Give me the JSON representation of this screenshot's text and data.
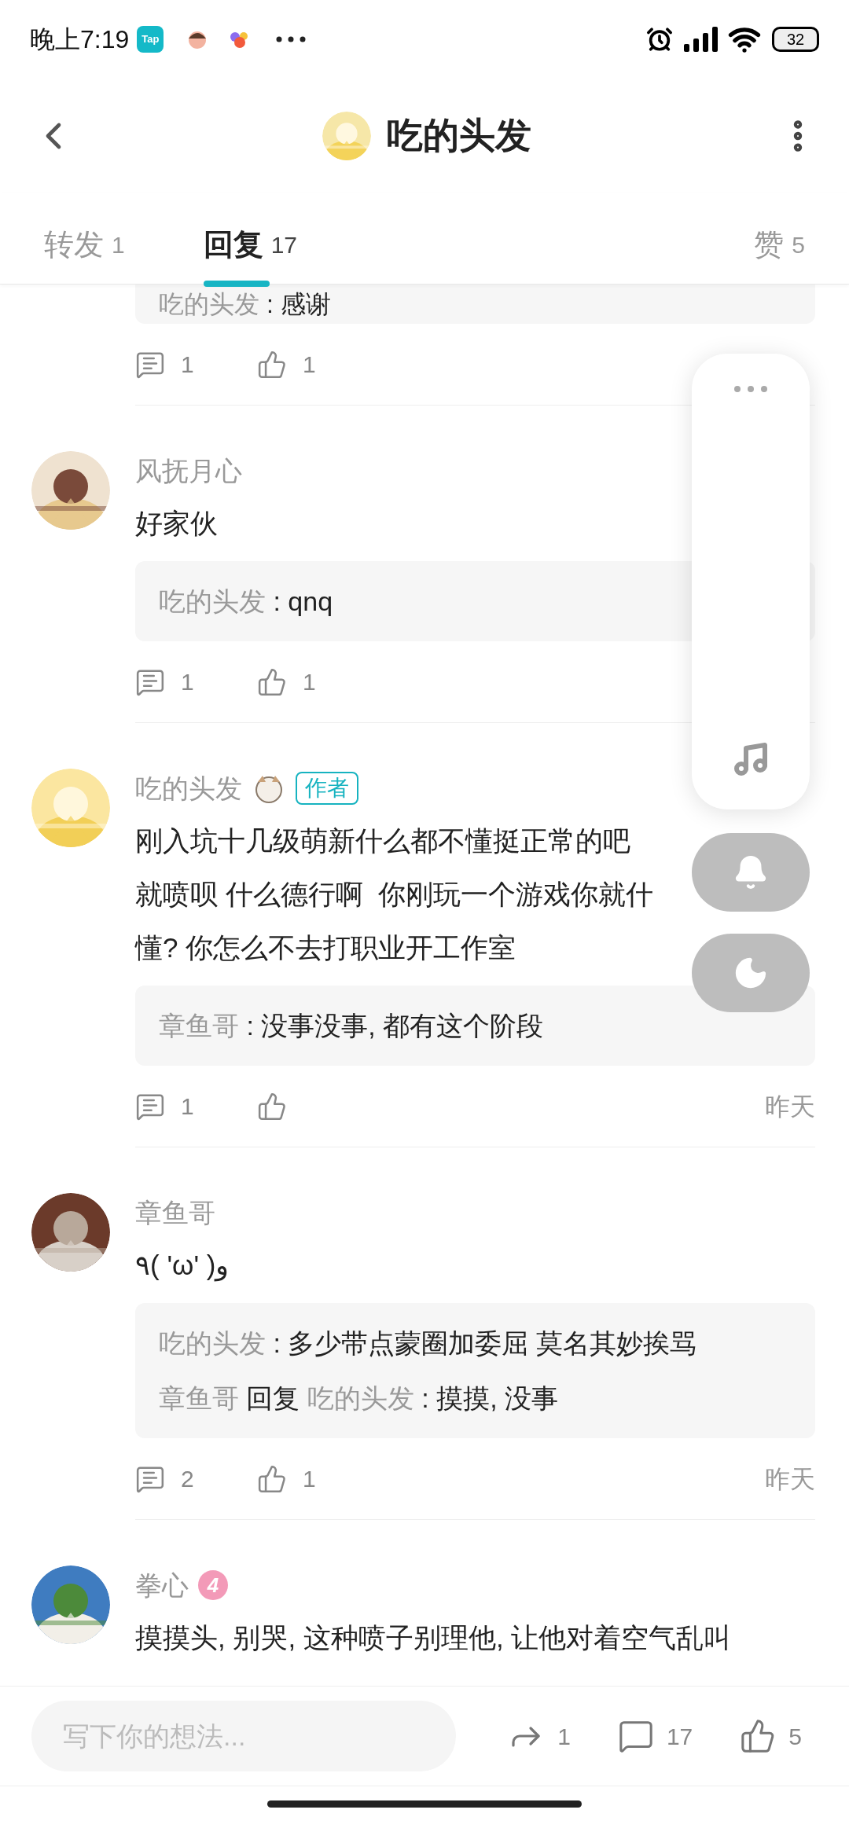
{
  "status_bar": {
    "time": "晚上7:19",
    "tap_icon_label": "Tap",
    "battery": "32"
  },
  "header": {
    "title": "吃的头发"
  },
  "tabs": [
    {
      "label": "转发",
      "count": "1",
      "selected": false
    },
    {
      "label": "回复",
      "count": "17",
      "selected": true
    },
    {
      "label": "赞",
      "count": "5",
      "selected": false
    }
  ],
  "comments": [
    {
      "kind": "partial",
      "replies": [
        {
          "author": "吃的头发",
          "text": ": 感谢"
        }
      ],
      "reply_count": "1",
      "like_count": "1"
    },
    {
      "kind": "full",
      "author": "风抚月心",
      "body": [
        "好家伙"
      ],
      "replies": [
        {
          "author": "吃的头发",
          "text": ": qnq"
        }
      ],
      "reply_count": "1",
      "like_count": "1"
    },
    {
      "kind": "full",
      "author": "吃的头发",
      "sticker": true,
      "author_tag": "作者",
      "body": [
        "刚入坑十几级萌新什么都不懂挺正常的吧",
        "就喷呗 什么德行啊  你刚玩一个游戏你就什",
        "懂? 你怎么不去打职业开工作室"
      ],
      "replies": [
        {
          "author": "章鱼哥",
          "text": ": 没事没事, 都有这个阶段"
        }
      ],
      "reply_count": "1",
      "time": "昨天"
    },
    {
      "kind": "full",
      "author": "章鱼哥",
      "body": [
        "٩( 'ω' )و"
      ],
      "replies": [
        {
          "author": "吃的头发",
          "text": ": 多少带点蒙圈加委屈 莫名其妙挨骂"
        },
        {
          "author": "章鱼哥",
          "verb": "回复",
          "reply_to": "吃的头发",
          "text": ": 摸摸, 没事"
        }
      ],
      "reply_count": "2",
      "like_count": "1",
      "time": "昨天"
    },
    {
      "kind": "full",
      "author": "拳心",
      "level": "4",
      "body": [
        "摸摸头, 别哭, 这种喷子别理他, 让他对着空气乱叫"
      ]
    }
  ],
  "bottom_bar": {
    "placeholder": "写下你的想法...",
    "share_count": "1",
    "comment_count": "17",
    "like_count": "5"
  }
}
